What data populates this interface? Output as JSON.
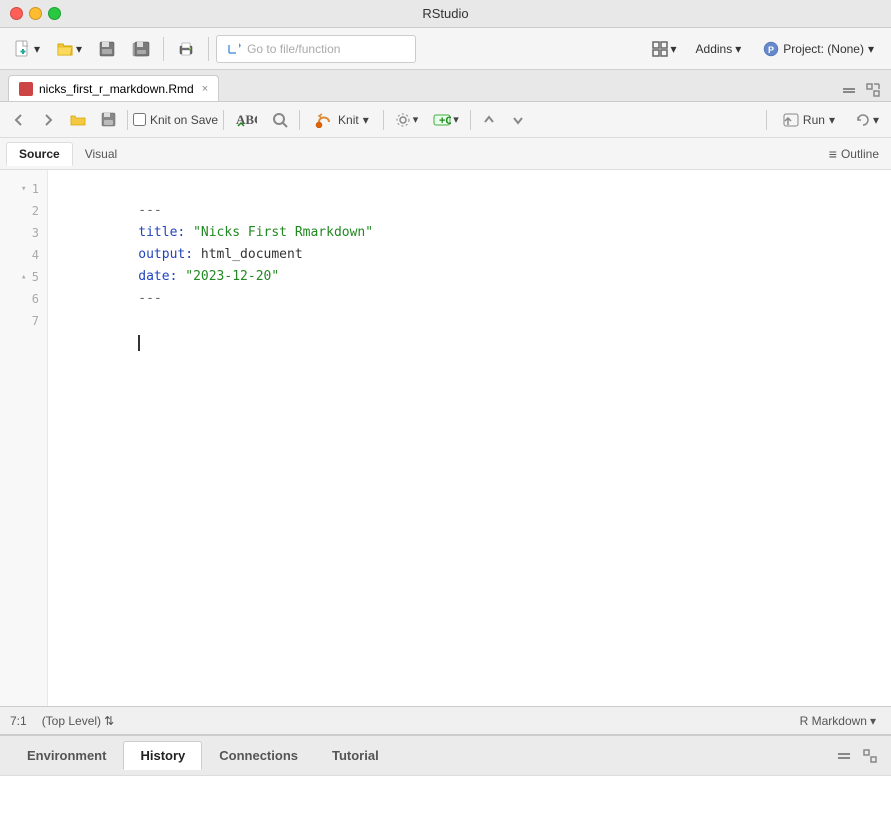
{
  "window": {
    "title": "RStudio"
  },
  "main_toolbar": {
    "goto_placeholder": "Go to file/function",
    "addins_label": "Addins",
    "addins_arrow": "▾",
    "project_label": "Project: (None)",
    "project_arrow": "▾"
  },
  "file_tab": {
    "name": "nicks_first_r_markdown.Rmd",
    "close_icon": "×"
  },
  "editor_toolbar": {
    "knit_on_save": "Knit on Save",
    "knit_label": "Knit",
    "knit_arrow": "▾",
    "run_label": "Run",
    "run_arrow": "▾",
    "rerun_arrow": "▾"
  },
  "view_tabs": {
    "source": "Source",
    "visual": "Visual",
    "outline": "≡ Outline"
  },
  "code": {
    "lines": [
      {
        "num": 1,
        "fold": "▾",
        "content": "---",
        "type": "dash"
      },
      {
        "num": 2,
        "fold": "",
        "content_key": "title:",
        "content_val": " \"Nicks First Rmarkdown\"",
        "type": "kv"
      },
      {
        "num": 3,
        "fold": "",
        "content_key": "output:",
        "content_val": " html_document",
        "type": "kv_plain"
      },
      {
        "num": 4,
        "fold": "",
        "content_key": "date:",
        "content_val": " \"2023-12-20\"",
        "type": "kv"
      },
      {
        "num": 5,
        "fold": "▴",
        "content": "---",
        "type": "dash"
      },
      {
        "num": 6,
        "fold": "",
        "content": "",
        "type": "empty"
      },
      {
        "num": 7,
        "fold": "",
        "content": "",
        "type": "cursor"
      }
    ]
  },
  "status_bar": {
    "position": "7:1",
    "scope": "(Top Level)",
    "scope_arrow": "⇅",
    "file_type": "R Markdown",
    "file_type_arrow": "▾"
  },
  "bottom_panel": {
    "tabs": [
      {
        "label": "Environment",
        "active": false
      },
      {
        "label": "History",
        "active": true
      },
      {
        "label": "Connections",
        "active": false
      },
      {
        "label": "Tutorial",
        "active": false
      }
    ]
  }
}
